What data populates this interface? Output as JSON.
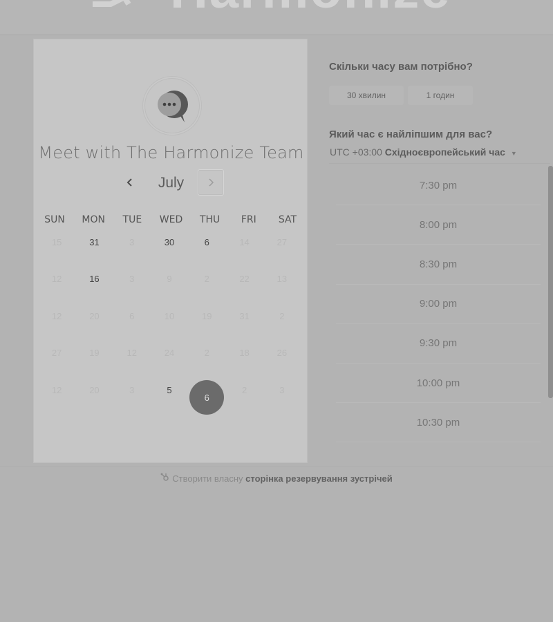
{
  "brand": {
    "name": "Harmonize"
  },
  "card": {
    "title": "Meet with The Harmonize Team",
    "month": "July",
    "weekdays": [
      "SUN",
      "MON",
      "TUE",
      "WED",
      "THU",
      "FRI",
      "SAT"
    ],
    "weeks": [
      [
        {
          "d": "15",
          "a": false
        },
        {
          "d": "31",
          "a": true
        },
        {
          "d": "3",
          "a": false
        },
        {
          "d": "30",
          "a": true
        },
        {
          "d": "6",
          "a": true
        },
        {
          "d": "14",
          "a": false
        },
        {
          "d": "27",
          "a": false
        }
      ],
      [
        {
          "d": "12",
          "a": false
        },
        {
          "d": "16",
          "a": true
        },
        {
          "d": "3",
          "a": false
        },
        {
          "d": "9",
          "a": false
        },
        {
          "d": "2",
          "a": false
        },
        {
          "d": "22",
          "a": false
        },
        {
          "d": "13",
          "a": false
        }
      ],
      [
        {
          "d": "12",
          "a": false
        },
        {
          "d": "20",
          "a": false
        },
        {
          "d": "6",
          "a": false
        },
        {
          "d": "10",
          "a": false
        },
        {
          "d": "19",
          "a": false
        },
        {
          "d": "31",
          "a": false
        },
        {
          "d": "2",
          "a": false
        }
      ],
      [
        {
          "d": "27",
          "a": false
        },
        {
          "d": "19",
          "a": false
        },
        {
          "d": "12",
          "a": false
        },
        {
          "d": "24",
          "a": false
        },
        {
          "d": "2",
          "a": false
        },
        {
          "d": "18",
          "a": false
        },
        {
          "d": "26",
          "a": false
        }
      ],
      [
        {
          "d": "12",
          "a": false
        },
        {
          "d": "20",
          "a": false
        },
        {
          "d": "3",
          "a": false
        },
        {
          "d": "5",
          "a": true
        },
        {
          "d": "6",
          "a": true,
          "selected": true
        },
        {
          "d": "2",
          "a": false
        },
        {
          "d": "3",
          "a": false
        }
      ]
    ]
  },
  "booking": {
    "duration_question": "Скільки часу вам потрібно?",
    "durations": [
      "30 хвилин",
      "1 годин"
    ],
    "time_question": "Який час є найліпшим для вас?",
    "timezone_prefix": "UTC +03:00",
    "timezone_name": "Східноєвропейський час",
    "slots": [
      "7:30 pm",
      "8:00 pm",
      "8:30 pm",
      "9:00 pm",
      "9:30 pm",
      "10:00 pm",
      "10:30 pm"
    ]
  },
  "footer": {
    "text": "Створити власну",
    "link": "сторінка резервування зустрічей"
  },
  "colors": {
    "selected_day": "#6b6b6b",
    "background": "#b3b3b3",
    "card": "#c6c6c6"
  },
  "icons": [
    "chat-bubble-icon",
    "chevron-left-icon",
    "chevron-right-icon",
    "caret-down-icon",
    "sprocket-icon"
  ]
}
